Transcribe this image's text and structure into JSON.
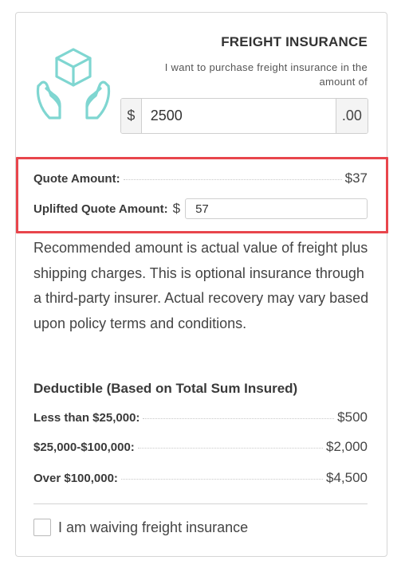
{
  "header": {
    "title": "FREIGHT INSURANCE",
    "subtitle": "I want to purchase freight insurance in the amount of",
    "icon": "hands-holding-box-icon",
    "icon_color": "#7fd6d1"
  },
  "amount": {
    "currency": "$",
    "value": "2500",
    "cents": ".00"
  },
  "quote": {
    "label": "Quote Amount:",
    "value": "$37",
    "uplifted_label": "Uplifted Quote Amount:",
    "uplifted_currency": "$",
    "uplifted_value": "57",
    "highlight_color": "#e8454c"
  },
  "description": "Recommended amount is actual value of freight plus shipping charges. This is optional insurance through a third-party insurer. Actual recovery may vary based upon policy terms and conditions.",
  "deductible": {
    "title": "Deductible (Based on Total Sum Insured)",
    "rows": [
      {
        "label": "Less than $25,000:",
        "value": "$500"
      },
      {
        "label": "$25,000-$100,000:",
        "value": "$2,000"
      },
      {
        "label": "Over $100,000:",
        "value": "$4,500"
      }
    ]
  },
  "waive": {
    "label": "I am waiving freight insurance",
    "checked": false
  }
}
